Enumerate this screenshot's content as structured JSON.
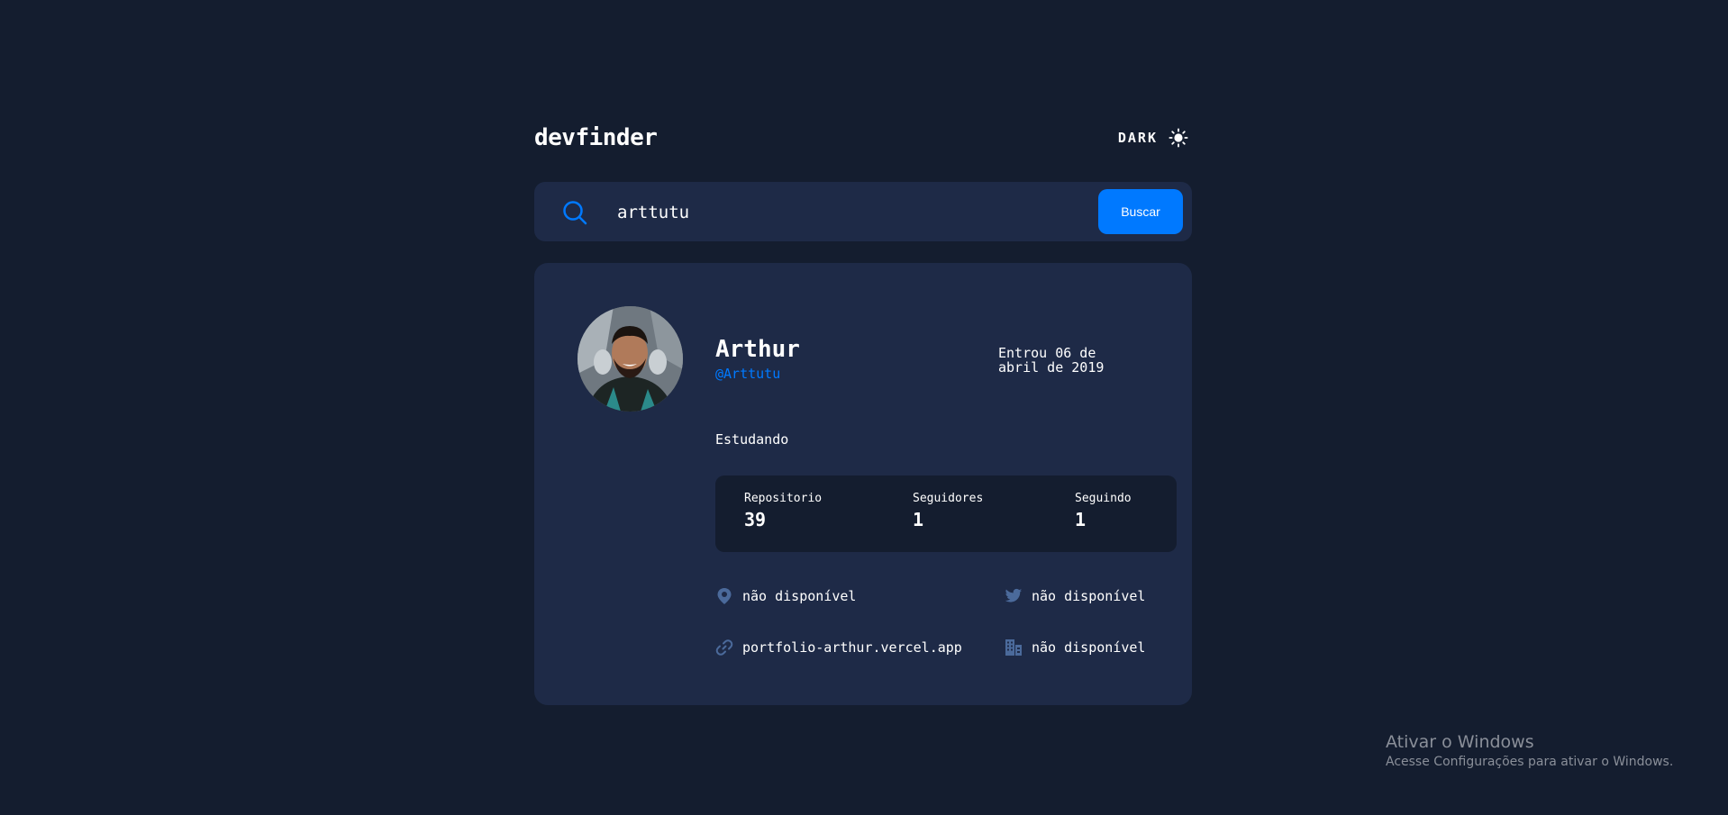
{
  "app": {
    "logo": "devfinder",
    "theme_label": "DARK",
    "theme_icon": "sun-icon"
  },
  "search": {
    "value": "arttutu",
    "placeholder": "",
    "button_label": "Buscar"
  },
  "profile": {
    "name": "Arthur",
    "login": "@Arttutu",
    "joined": "Entrou 06 de abril de 2019",
    "bio": "Estudando",
    "stats": [
      {
        "label": "Repositorio",
        "value": "39"
      },
      {
        "label": "Seguidores",
        "value": "1"
      },
      {
        "label": "Seguindo",
        "value": "1"
      }
    ],
    "links": {
      "location": "não disponível",
      "twitter": "não disponível",
      "blog": "portfolio-arthur.vercel.app",
      "company": "não disponível"
    }
  },
  "watermark": {
    "title": "Ativar o Windows",
    "subtitle": "Acesse Configurações para ativar o Windows."
  },
  "colors": {
    "background": "#141d2f",
    "card": "#1e2a47",
    "accent": "#0079ff",
    "icon": "#4b6a9b"
  }
}
